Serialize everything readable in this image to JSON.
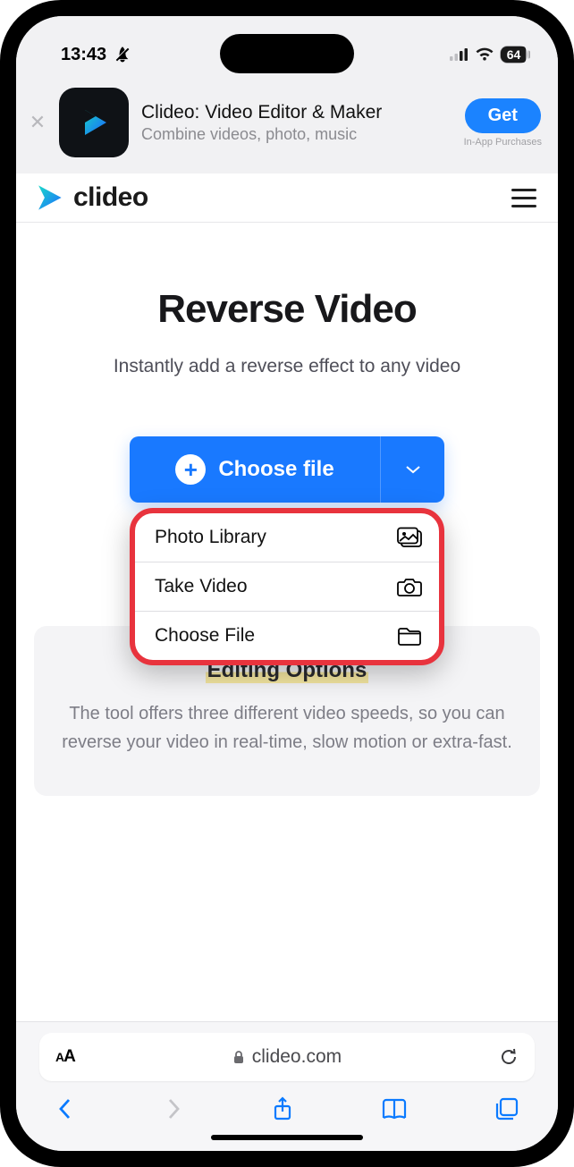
{
  "status": {
    "time": "13:43",
    "battery": "64"
  },
  "banner": {
    "title": "Clideo: Video Editor & Maker",
    "subtitle": "Combine videos, photo, music",
    "cta": "Get",
    "iap": "In-App Purchases"
  },
  "brand": {
    "name": "clideo"
  },
  "hero": {
    "title": "Reverse Video",
    "subtitle": "Instantly add a reverse effect to any video"
  },
  "choose": {
    "label": "Choose file"
  },
  "menu": {
    "items": [
      {
        "label": "Photo Library"
      },
      {
        "label": "Take Video"
      },
      {
        "label": "Choose File"
      }
    ]
  },
  "card": {
    "title": "Editing Options",
    "body": "The tool offers three different video speeds, so you can reverse your video in real-time, slow motion or extra-fast."
  },
  "safari": {
    "domain": "clideo.com"
  }
}
